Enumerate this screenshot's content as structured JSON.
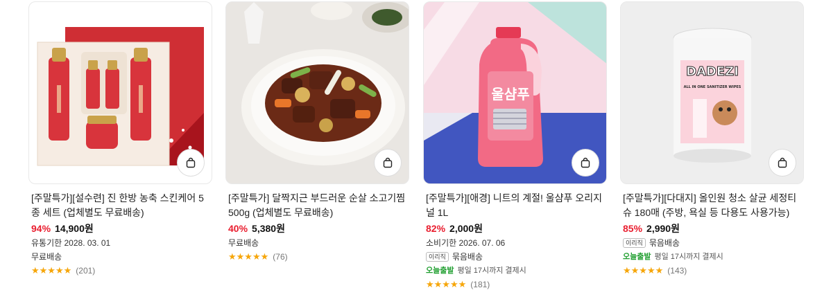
{
  "products": [
    {
      "title": "[주말특가][설수련] 진 한방 농축 스킨케어 5종 세트 (업체별도 무료배송)",
      "discount": "94%",
      "price": "14,900원",
      "expiry": "유통기한 2028. 03. 01",
      "shipping": "무료배송",
      "reviews": "(201)",
      "image_icon": "cosmetics-gift-set-image"
    },
    {
      "title": "[주말특가] 달짝지근 부드러운 순살 소고기찜 500g (업체별도 무료배송)",
      "discount": "40%",
      "price": "5,380원",
      "shipping": "무료배송",
      "reviews": "(76)",
      "image_icon": "braised-beef-dish-image"
    },
    {
      "title": "[주말특가][애경] 니트의 계절! 울샴푸 오리지널 1L",
      "discount": "82%",
      "price": "2,000원",
      "expiry": "소비기한 2026. 07. 06",
      "bundle_badge": "이리직",
      "bundle": "묶음배송",
      "today": "오늘출발",
      "today_note": "평일 17시까지 결제시",
      "reviews": "(181)",
      "bottle_label": "울샴푸",
      "image_icon": "detergent-bottle-image"
    },
    {
      "title": "[주말특가][다대지] 올인원 청소 살균 세정티슈 180매 (주방, 욕실 등 다용도 사용가능)",
      "discount": "85%",
      "price": "2,990원",
      "bundle_badge": "이리직",
      "bundle": "묶음배송",
      "today": "오늘출발",
      "today_note": "평일 17시까지 결제시",
      "reviews": "(143)",
      "canister_brand": "DADEZI",
      "canister_sub": "ALL IN ONE SANITIZER WIPES",
      "image_icon": "wipes-canister-image"
    }
  ],
  "stars": "★★★★★",
  "colors": {
    "discount": "#e91e2f",
    "star": "#f6a60a",
    "today": "#1f9e2f"
  }
}
